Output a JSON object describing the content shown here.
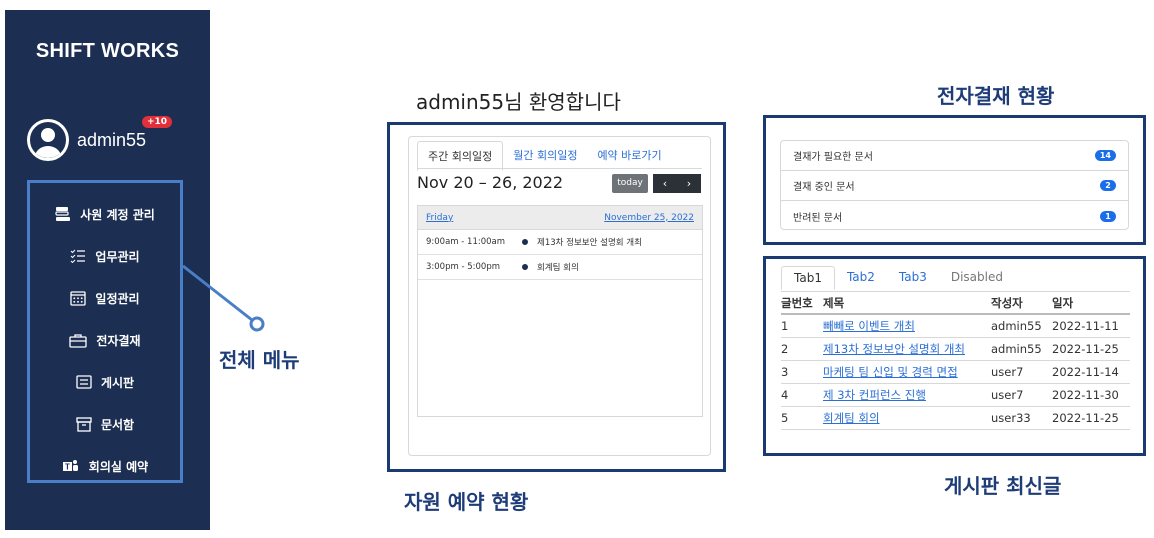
{
  "sidebar": {
    "brand": "SHIFT WORKS",
    "username": "admin55",
    "notification_badge": "+10",
    "items": [
      {
        "label": "사원 계정 관리",
        "icon": "user-account-icon"
      },
      {
        "label": "업무관리",
        "icon": "checklist-icon"
      },
      {
        "label": "일정관리",
        "icon": "calendar-icon"
      },
      {
        "label": "전자결재",
        "icon": "briefcase-icon"
      },
      {
        "label": "게시판",
        "icon": "board-icon"
      },
      {
        "label": "문서함",
        "icon": "archive-icon"
      },
      {
        "label": "회의실 예약",
        "icon": "teams-icon"
      }
    ]
  },
  "annotations": {
    "menu": "전체 메뉴",
    "resource": "자원 예약 현황",
    "approval": "전자결재 현황",
    "board": "게시판 최신글"
  },
  "welcome": "admin55님 환영합니다",
  "calendar": {
    "tabs": [
      "주간 회의일정",
      "월간 회의일정",
      "예약 바로가기"
    ],
    "range": "Nov 20 – 26, 2022",
    "today_label": "today",
    "prev": "‹",
    "next": "›",
    "day_name": "Friday",
    "day_date": "November 25, 2022",
    "events": [
      {
        "time": "9:00am - 11:00am",
        "title": "제13차 정보보안 설명회 개최"
      },
      {
        "time": "3:00pm - 5:00pm",
        "title": "회계팀 회의"
      }
    ]
  },
  "approval": {
    "rows": [
      {
        "label": "결재가 필요한 문서",
        "count": "14"
      },
      {
        "label": "결재 중인 문서",
        "count": "2"
      },
      {
        "label": "반려된 문서",
        "count": "1"
      }
    ]
  },
  "board": {
    "tabs": [
      "Tab1",
      "Tab2",
      "Tab3",
      "Disabled"
    ],
    "columns": [
      "글번호",
      "제목",
      "작성자",
      "일자"
    ],
    "rows": [
      {
        "no": "1",
        "title": "빼빼로 이벤트 개최",
        "author": "admin55",
        "date": "2022-11-11"
      },
      {
        "no": "2",
        "title": "제13차 정보보안 설명회 개최",
        "author": "admin55",
        "date": "2022-11-25"
      },
      {
        "no": "3",
        "title": "마케팅 팀 신입 및 경력 면접",
        "author": "user7",
        "date": "2022-11-14"
      },
      {
        "no": "4",
        "title": "제 3차 컨퍼런스 진행",
        "author": "user7",
        "date": "2022-11-30"
      },
      {
        "no": "5",
        "title": "회계팀 회의",
        "author": "user33",
        "date": "2022-11-25"
      }
    ]
  },
  "colors": {
    "sidebar": "#1c2e52",
    "accent": "#2b6fd4",
    "annotation": "#1d3c78"
  }
}
